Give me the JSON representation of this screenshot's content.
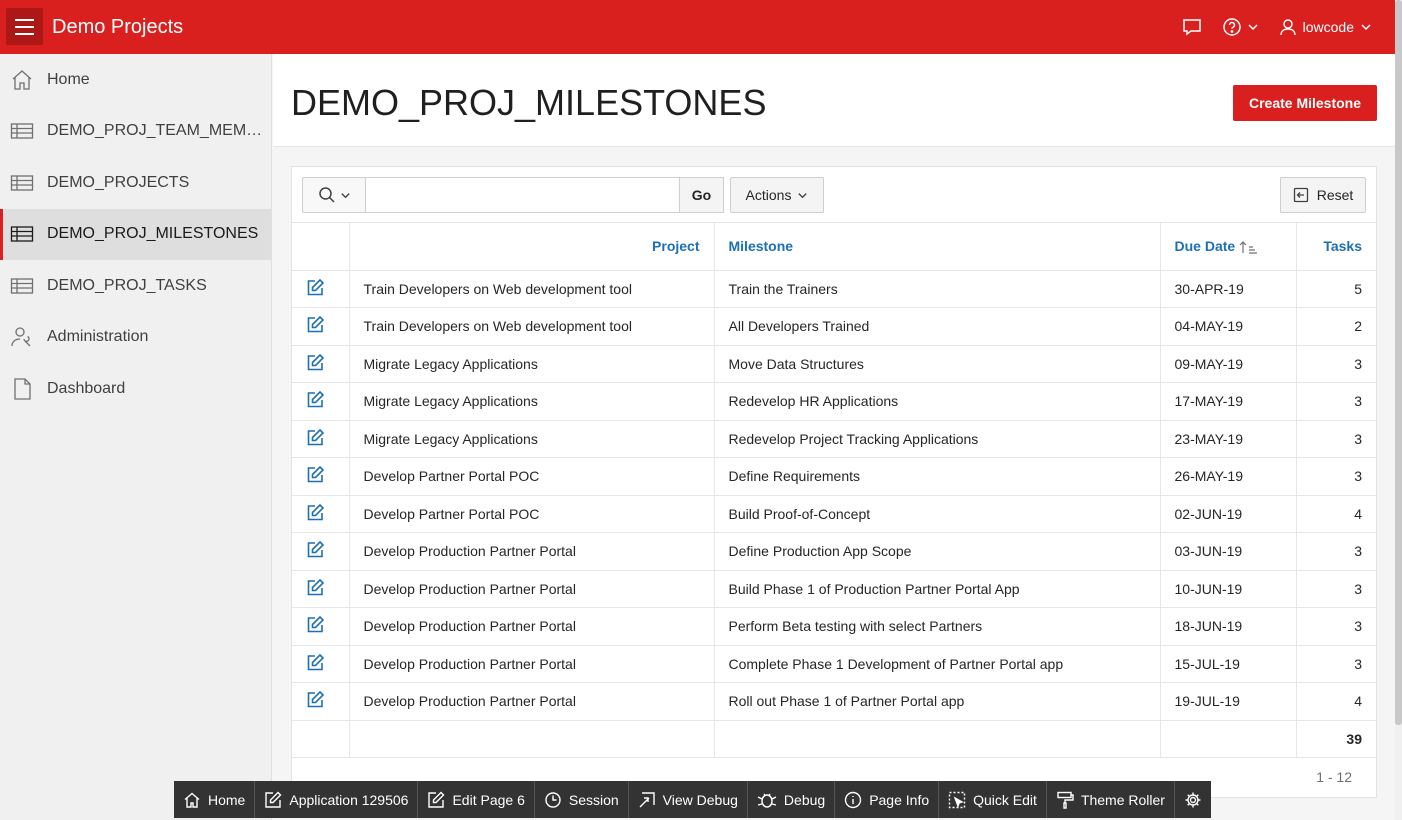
{
  "header": {
    "app_title": "Demo Projects",
    "user_name": "lowcode",
    "icons": {
      "menu": "hamburger-icon",
      "feedback": "chat-icon",
      "help": "help-icon",
      "user": "user-icon"
    }
  },
  "sidebar": {
    "items": [
      {
        "label": "Home",
        "icon": "home-icon",
        "active": false
      },
      {
        "label": "DEMO_PROJ_TEAM_MEMBE...",
        "icon": "table-icon",
        "active": false
      },
      {
        "label": "DEMO_PROJECTS",
        "icon": "table-icon",
        "active": false
      },
      {
        "label": "DEMO_PROJ_MILESTONES",
        "icon": "table-icon",
        "active": true
      },
      {
        "label": "DEMO_PROJ_TASKS",
        "icon": "table-icon",
        "active": false
      },
      {
        "label": "Administration",
        "icon": "user-wrench-icon",
        "active": false
      },
      {
        "label": "Dashboard",
        "icon": "document-icon",
        "active": false
      }
    ]
  },
  "page": {
    "title": "DEMO_PROJ_MILESTONES",
    "create_button": "Create Milestone"
  },
  "report": {
    "search_placeholder": "",
    "go_label": "Go",
    "actions_label": "Actions",
    "reset_label": "Reset",
    "columns": {
      "project": "Project",
      "milestone": "Milestone",
      "due_date": "Due Date",
      "tasks": "Tasks"
    },
    "rows": [
      {
        "project": "Train Developers on Web development tool",
        "milestone": "Train the Trainers",
        "due_date": "30-APR-19",
        "tasks": "5"
      },
      {
        "project": "Train Developers on Web development tool",
        "milestone": "All Developers Trained",
        "due_date": "04-MAY-19",
        "tasks": "2"
      },
      {
        "project": "Migrate Legacy Applications",
        "milestone": "Move Data Structures",
        "due_date": "09-MAY-19",
        "tasks": "3"
      },
      {
        "project": "Migrate Legacy Applications",
        "milestone": "Redevelop HR Applications",
        "due_date": "17-MAY-19",
        "tasks": "3"
      },
      {
        "project": "Migrate Legacy Applications",
        "milestone": "Redevelop Project Tracking Applications",
        "due_date": "23-MAY-19",
        "tasks": "3"
      },
      {
        "project": "Develop Partner Portal POC",
        "milestone": "Define Requirements",
        "due_date": "26-MAY-19",
        "tasks": "3"
      },
      {
        "project": "Develop Partner Portal POC",
        "milestone": "Build Proof-of-Concept",
        "due_date": "02-JUN-19",
        "tasks": "4"
      },
      {
        "project": "Develop Production Partner Portal",
        "milestone": "Define Production App Scope",
        "due_date": "03-JUN-19",
        "tasks": "3"
      },
      {
        "project": "Develop Production Partner Portal",
        "milestone": "Build Phase 1 of Production Partner Portal App",
        "due_date": "10-JUN-19",
        "tasks": "3"
      },
      {
        "project": "Develop Production Partner Portal",
        "milestone": "Perform Beta testing with select Partners",
        "due_date": "18-JUN-19",
        "tasks": "3"
      },
      {
        "project": "Develop Production Partner Portal",
        "milestone": "Complete Phase 1 Development of Partner Portal app",
        "due_date": "15-JUL-19",
        "tasks": "3"
      },
      {
        "project": "Develop Production Partner Portal",
        "milestone": "Roll out Phase 1 of Partner Portal app",
        "due_date": "19-JUL-19",
        "tasks": "4"
      }
    ],
    "total_tasks": "39",
    "pagination": "1 - 12"
  },
  "devbar": {
    "items": [
      {
        "label": "Home",
        "icon": "home-icon"
      },
      {
        "label": "Application 129506",
        "icon": "edit-icon"
      },
      {
        "label": "Edit Page 6",
        "icon": "edit-icon"
      },
      {
        "label": "Session",
        "icon": "clock-icon"
      },
      {
        "label": "View Debug",
        "icon": "view-debug-icon"
      },
      {
        "label": "Debug",
        "icon": "bug-icon"
      },
      {
        "label": "Page Info",
        "icon": "info-icon"
      },
      {
        "label": "Quick Edit",
        "icon": "quick-edit-icon"
      },
      {
        "label": "Theme Roller",
        "icon": "paint-roller-icon"
      },
      {
        "label": "",
        "icon": "gear-icon"
      }
    ]
  },
  "colors": {
    "brand": "#d9201f",
    "link": "#1d6fb8",
    "devbar": "#333333"
  }
}
